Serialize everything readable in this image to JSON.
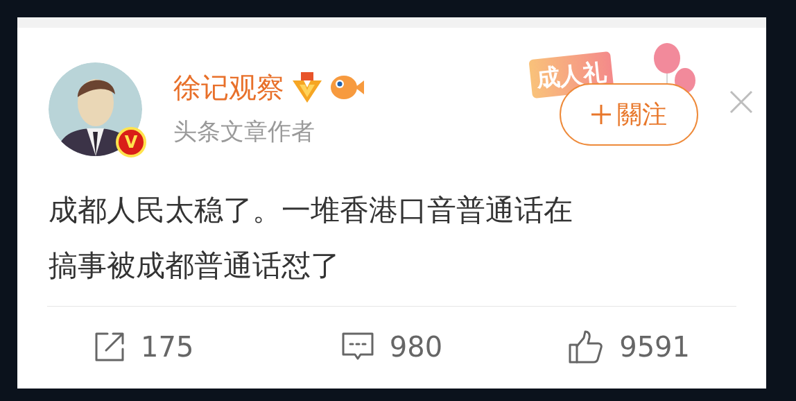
{
  "post": {
    "author": {
      "name": "徐记观察",
      "verified_badge": "V",
      "subtitle": "头条文章作者"
    },
    "sticker": "成人礼",
    "follow_button": "關注",
    "text": [
      "成都人民太稳了。一堆香港口音普通话在",
      "搞事被成都普通话怼了"
    ],
    "stats": [
      {
        "kind": "repost",
        "count": "175"
      },
      {
        "kind": "comment",
        "count": "980"
      },
      {
        "kind": "like",
        "count": "9591"
      }
    ]
  }
}
